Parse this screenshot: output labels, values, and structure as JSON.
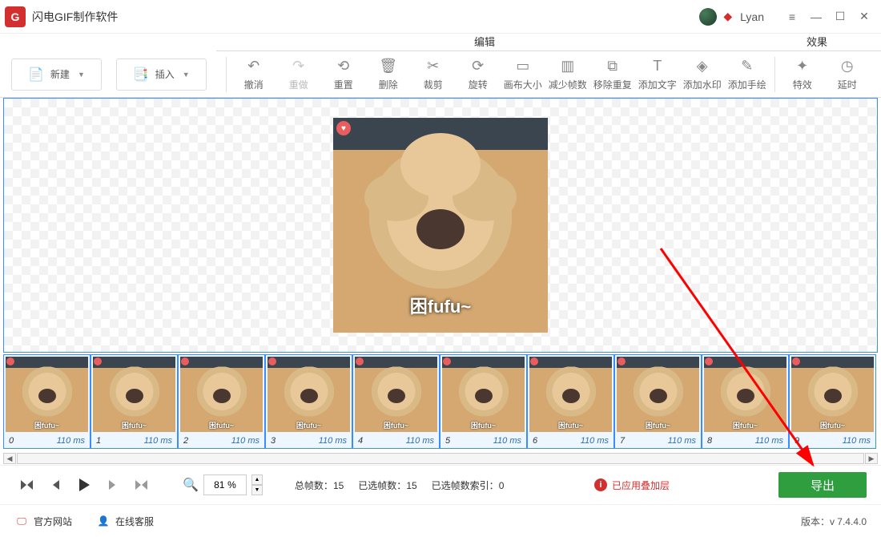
{
  "title_bar": {
    "app_name": "闪电GIF制作软件",
    "username": "Lyan"
  },
  "toolbar": {
    "new_label": "新建",
    "insert_label": "插入",
    "tools": [
      {
        "label": "撤消",
        "icon": "↶"
      },
      {
        "label": "重做",
        "icon": "↷"
      },
      {
        "label": "重置",
        "icon": "⟲"
      },
      {
        "label": "删除",
        "icon": "🗑"
      },
      {
        "label": "裁剪",
        "icon": "✂"
      },
      {
        "label": "旋转",
        "icon": "⟳"
      },
      {
        "label": "画布大小",
        "icon": "▭"
      },
      {
        "label": "减少帧数",
        "icon": "▥"
      },
      {
        "label": "移除重复",
        "icon": "⧉"
      },
      {
        "label": "添加文字",
        "icon": "T"
      },
      {
        "label": "添加水印",
        "icon": "◈"
      },
      {
        "label": "添加手绘",
        "icon": "✎"
      }
    ],
    "effects": [
      {
        "label": "特效",
        "icon": "✦"
      },
      {
        "label": "延时",
        "icon": "◷"
      }
    ],
    "tab_edit": "编辑",
    "tab_effect": "效果"
  },
  "preview": {
    "caption": "困fufu~"
  },
  "timeline": {
    "frames": [
      {
        "index": "0",
        "duration": "110 ms"
      },
      {
        "index": "1",
        "duration": "110 ms"
      },
      {
        "index": "2",
        "duration": "110 ms"
      },
      {
        "index": "3",
        "duration": "110 ms"
      },
      {
        "index": "4",
        "duration": "110 ms"
      },
      {
        "index": "5",
        "duration": "110 ms"
      },
      {
        "index": "6",
        "duration": "110 ms"
      },
      {
        "index": "7",
        "duration": "110 ms"
      },
      {
        "index": "8",
        "duration": "110 ms"
      },
      {
        "index": "9",
        "duration": "110 ms"
      }
    ],
    "thumb_caption": "困fufu~"
  },
  "playback": {
    "zoom_value": "81",
    "zoom_unit": "%",
    "total_frames_label": "总帧数：",
    "total_frames": "15",
    "selected_frames_label": "已选帧数：",
    "selected_frames": "15",
    "selected_index_label": "已选帧数索引：",
    "selected_index": "0",
    "warning": "已应用叠加层",
    "export_label": "导出"
  },
  "footer": {
    "official_site": "官方网站",
    "support": "在线客服",
    "version_label": "版本：",
    "version": "v 7.4.4.0"
  }
}
